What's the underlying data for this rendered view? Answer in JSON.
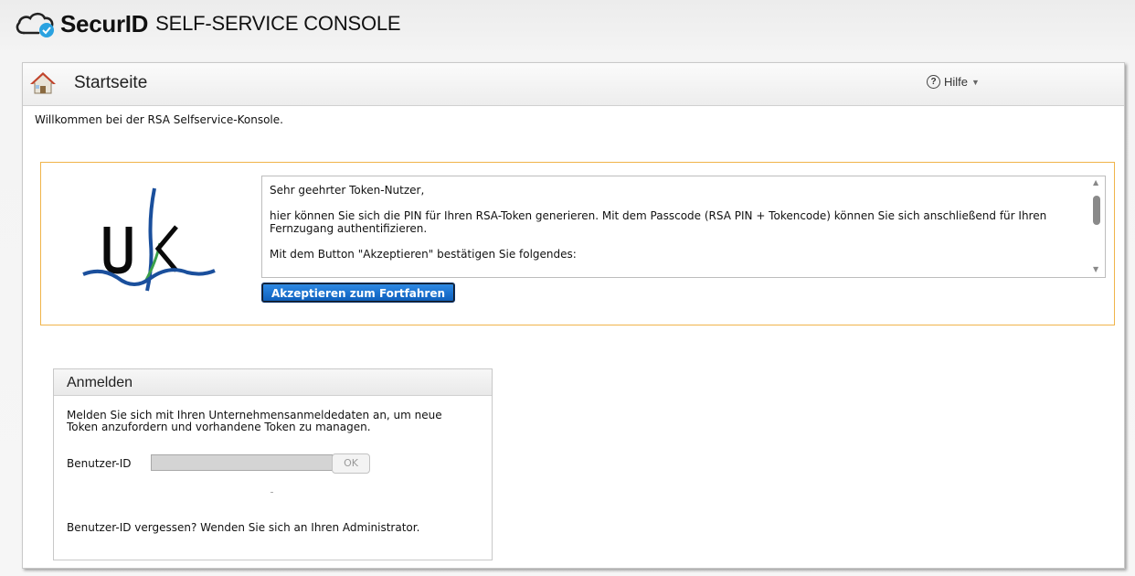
{
  "brand": {
    "name": "SecurID",
    "trademark": "®",
    "subtitle": "SELF-SERVICE CONSOLE",
    "icon": "cloud-check-icon"
  },
  "header": {
    "title": "Startseite",
    "home_icon": "home-icon",
    "help_label": "Hilfe",
    "help_icon": "question-circle-icon"
  },
  "welcome_text": "Willkommen bei der RSA Selfservice-Konsole.",
  "consent": {
    "logo_text": "UK",
    "greeting": "Sehr geehrter Token-Nutzer,",
    "paragraph": "hier können Sie sich die PIN für Ihren RSA-Token generieren. Mit dem Passcode (RSA PIN + Tokencode) können Sie sich anschließend für Ihren Fernzugang authentifizieren.",
    "paragraph2": "Mit dem Button \"Akzeptieren\" bestätigen Sie folgendes:",
    "accept_button": "Akzeptieren zum Fortfahren",
    "accent_color": "#f0b44a"
  },
  "login": {
    "title": "Anmelden",
    "description": "Melden Sie sich mit Ihren Unternehmensanmeldedaten an, um neue Token anzufordern und vorhandene Token zu managen.",
    "user_id_label": "Benutzer-ID",
    "user_id_value": "",
    "ok_button": "OK",
    "forgot_text": "Benutzer-ID vergessen? Wenden Sie sich an Ihren Administrator."
  }
}
